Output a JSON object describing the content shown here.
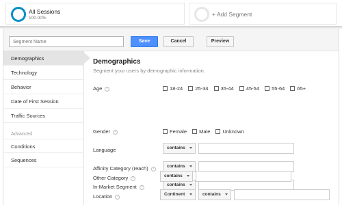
{
  "segments": [
    {
      "name": "All Sessions",
      "percent": "100.00%",
      "active": true
    },
    {
      "name": "+ Add Segment",
      "active": false
    }
  ],
  "toolbar": {
    "name_placeholder": "Segment Name",
    "save_label": "Save",
    "cancel_label": "Cancel",
    "preview_label": "Preview"
  },
  "sidebar": {
    "items": [
      {
        "label": "Demographics",
        "selected": true
      },
      {
        "label": "Technology"
      },
      {
        "label": "Behavior"
      },
      {
        "label": "Date of First Session"
      },
      {
        "label": "Traffic Sources"
      }
    ],
    "advanced_label": "Advanced",
    "advanced_items": [
      {
        "label": "Conditions"
      },
      {
        "label": "Sequences"
      }
    ]
  },
  "main": {
    "heading": "Demographics",
    "subheading": "Segment your users by demographic information.",
    "age": {
      "label": "Age",
      "options": [
        "18-24",
        "25-34",
        "35-44",
        "45-54",
        "55-64",
        "65+"
      ]
    },
    "gender": {
      "label": "Gender",
      "options": [
        "Female",
        "Male",
        "Unknown"
      ]
    },
    "language": {
      "label": "Language",
      "operator": "contains"
    },
    "affinity": {
      "label": "Affinity Category (reach)",
      "operator": "contains"
    },
    "in_market": {
      "label": "In-Market Segment",
      "operator": "contains"
    },
    "other": {
      "label": "Other Category",
      "operator": "contains"
    },
    "location": {
      "label": "Location",
      "scope": "Continent",
      "operator": "contains"
    }
  },
  "help_glyph": "?",
  "colors": {
    "accent": "#058dc7",
    "save_button": "#4d90fe",
    "selected_bg": "#e4e4e4"
  }
}
